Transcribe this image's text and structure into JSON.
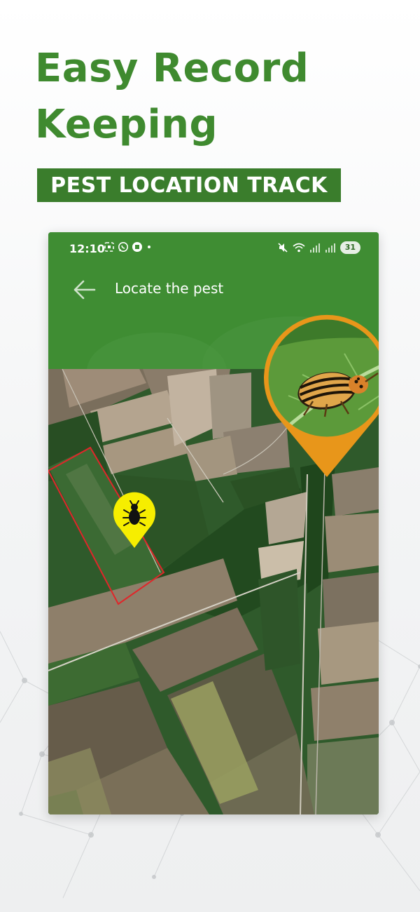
{
  "headline": {
    "line1": "Easy Record",
    "line2": "Keeping"
  },
  "badge": {
    "label": "PEST LOCATION TRACK"
  },
  "status_bar": {
    "time": "12:10",
    "battery": "31"
  },
  "app_bar": {
    "title": "Locate the pest"
  },
  "icons": {
    "back": "arrow-left-icon",
    "pest_marker": "bug-icon",
    "photo_marker": "pest-photo-icon"
  },
  "colors": {
    "brand_green": "#3f8a2f",
    "badge_green": "#3a7d2c",
    "app_bar_green": "#3f8d33",
    "pest_marker_yellow": "#f6ee00",
    "photo_marker_orange": "#e8961a",
    "field_boundary_red": "#e0262a"
  }
}
